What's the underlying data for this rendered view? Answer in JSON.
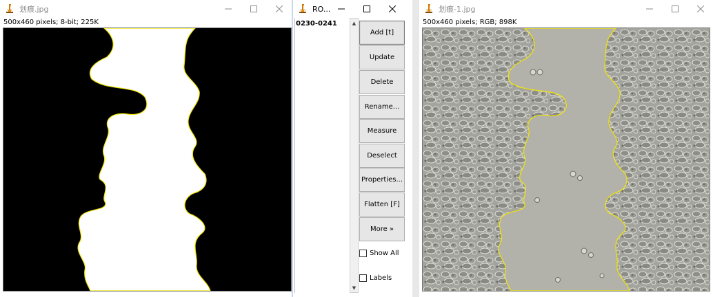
{
  "window_left": {
    "title": "划痕.jpg",
    "info": "500x460 pixels; 8-bit; 225K",
    "icon": "imagej-microscope-icon"
  },
  "window_roi": {
    "title": "RO...",
    "icon": "imagej-microscope-icon",
    "list_items": [
      "0230-0241"
    ],
    "buttons": [
      {
        "label": "Add [t]"
      },
      {
        "label": "Update"
      },
      {
        "label": "Delete"
      },
      {
        "label": "Rename..."
      },
      {
        "label": "Measure"
      },
      {
        "label": "Deselect"
      },
      {
        "label": "Properties..."
      },
      {
        "label": "Flatten [F]"
      },
      {
        "label": "More »"
      }
    ],
    "checkboxes": [
      {
        "label": "Show All",
        "checked": false
      },
      {
        "label": "Labels",
        "checked": false
      }
    ]
  },
  "window_right": {
    "title": "划痕-1.jpg",
    "info": "500x460 pixels; RGB; 898K",
    "icon": "imagej-microscope-icon"
  },
  "colors": {
    "roi_outline": "#f2e500",
    "mask_black": "#000000",
    "mask_white": "#ffffff",
    "micro_bg": "#a8a8a2",
    "gap_fill": "#b2b2aa"
  }
}
